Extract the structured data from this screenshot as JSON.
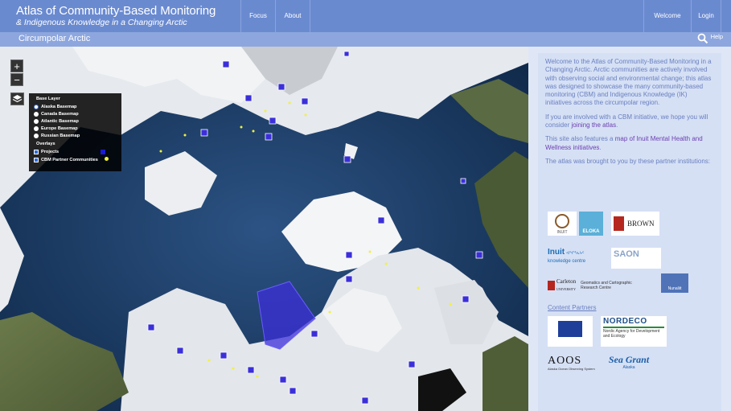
{
  "header": {
    "title": "Atlas of Community-Based Monitoring",
    "subtitle": "& Indigenous Knowledge in a Changing Arctic",
    "nav": [
      "Focus",
      "About"
    ],
    "welcome": "Welcome",
    "login": "Login"
  },
  "subbar": {
    "region": "Circumpolar Arctic",
    "help": "Help"
  },
  "map": {
    "zoom_in": "+",
    "zoom_out": "−",
    "legend": {
      "base_heading": "Base Layer",
      "base_layers": [
        "Alaska Basemap",
        "Canada Basemap",
        "Atlantic Basemap",
        "Europe Basemap",
        "Russian Basemap"
      ],
      "selected_base": "Alaska Basemap",
      "overlay_heading": "Overlays",
      "overlays": [
        "Projects",
        "CBM Partner Communities"
      ],
      "project_color": "#1a1ad6",
      "community_color": "#f2f23a"
    },
    "marker_color": "#3b2fd9"
  },
  "sidebar": {
    "intro": "Welcome to the Atlas of Community-Based Monitoring in a Changing Arctic. Arctic communities are actively involved with observing social and environmental change; this atlas was designed to showcase the many community-based monitoring (CBM) and Indigenous Knowledge (IK) initiatives across the circumpolar region.",
    "join_pre": "If you are involved with a CBM initiative, we hope you will consider ",
    "join_link": "joining the atlas",
    "join_post": ".",
    "map_pre": "This site also features a ",
    "map_link": "map of Inuit Mental Health and Wellness initiatives",
    "map_post": ".",
    "partners_text": "The atlas was brought to you by these partner institutions:",
    "content_partners": "Content Partners",
    "logos": {
      "inuit": "INUIT",
      "elokas": "ELOKA",
      "brown": "BROWN",
      "inuit_knowledge": "Inuit",
      "inuit_knowledge_sub": "knowledge centre",
      "inuit_knowledge_syll": "ᐊᖏᕐᕆᔭᑦ",
      "saon": "SAON",
      "carleton": "Carleton",
      "carleton_sub": "UNIVERSITY",
      "gcrc": "Geomatics and Cartographic Research Centre",
      "nunaliit": "Nunaliit",
      "nordeco": "NORDECO",
      "nordeco_sub": "Nordic Agency for Development and Ecology",
      "aoos": "AOOS",
      "aoos_sub": "Alaska Ocean Observing System",
      "seagrant": "Sea Grant",
      "seagrant_sub": "Alaska"
    }
  }
}
